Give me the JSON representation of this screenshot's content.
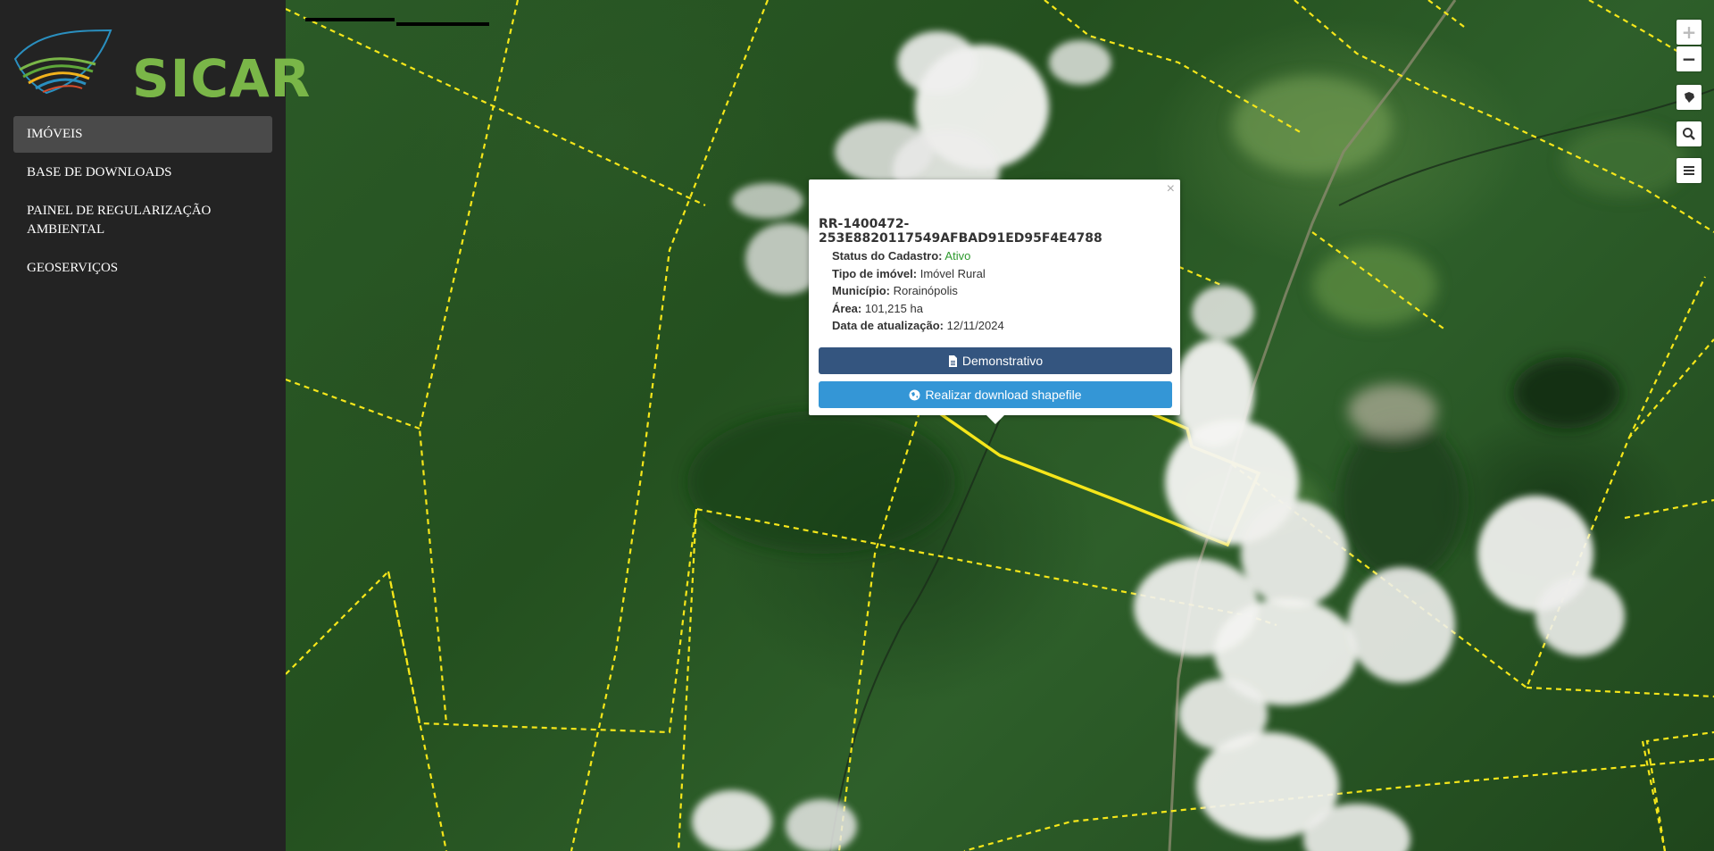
{
  "brand": {
    "name": "SICAR"
  },
  "nav": {
    "items": [
      {
        "label": "IMÓVEIS",
        "active": true
      },
      {
        "label": "BASE DE DOWNLOADS",
        "active": false
      },
      {
        "label": "PAINEL DE REGULARIZAÇÃO AMBIENTAL",
        "active": false
      },
      {
        "label": "GEOSERVIÇOS",
        "active": false
      }
    ]
  },
  "map_controls": {
    "zoom_in": "+",
    "zoom_out": "−",
    "brazil_icon": "brazil-map-icon",
    "search_icon": "search-icon",
    "layers_icon": "menu-icon"
  },
  "popup": {
    "close": "×",
    "title": "RR-1400472-253E8820117549AFBAD91ED95F4E4788",
    "fields": [
      {
        "label": "Status do Cadastro:",
        "value": "Ativo"
      },
      {
        "label": "Tipo de imóvel:",
        "value": "Imóvel Rural"
      },
      {
        "label": "Município:",
        "value": "Rorainópolis"
      },
      {
        "label": "Área:",
        "value": "101,215 ha"
      },
      {
        "label": "Data de atualização:",
        "value": "12/11/2024"
      }
    ],
    "btn_demo": "Demonstrativo",
    "btn_download": "Realizar download shapefile"
  },
  "colors": {
    "sidebar_bg": "#232323",
    "brand_green": "#7ab648",
    "boundary_yellow": "#f5e61a",
    "btn_demo": "#34557f",
    "btn_download": "#3496d6",
    "status_active": "#2e9a2e"
  }
}
